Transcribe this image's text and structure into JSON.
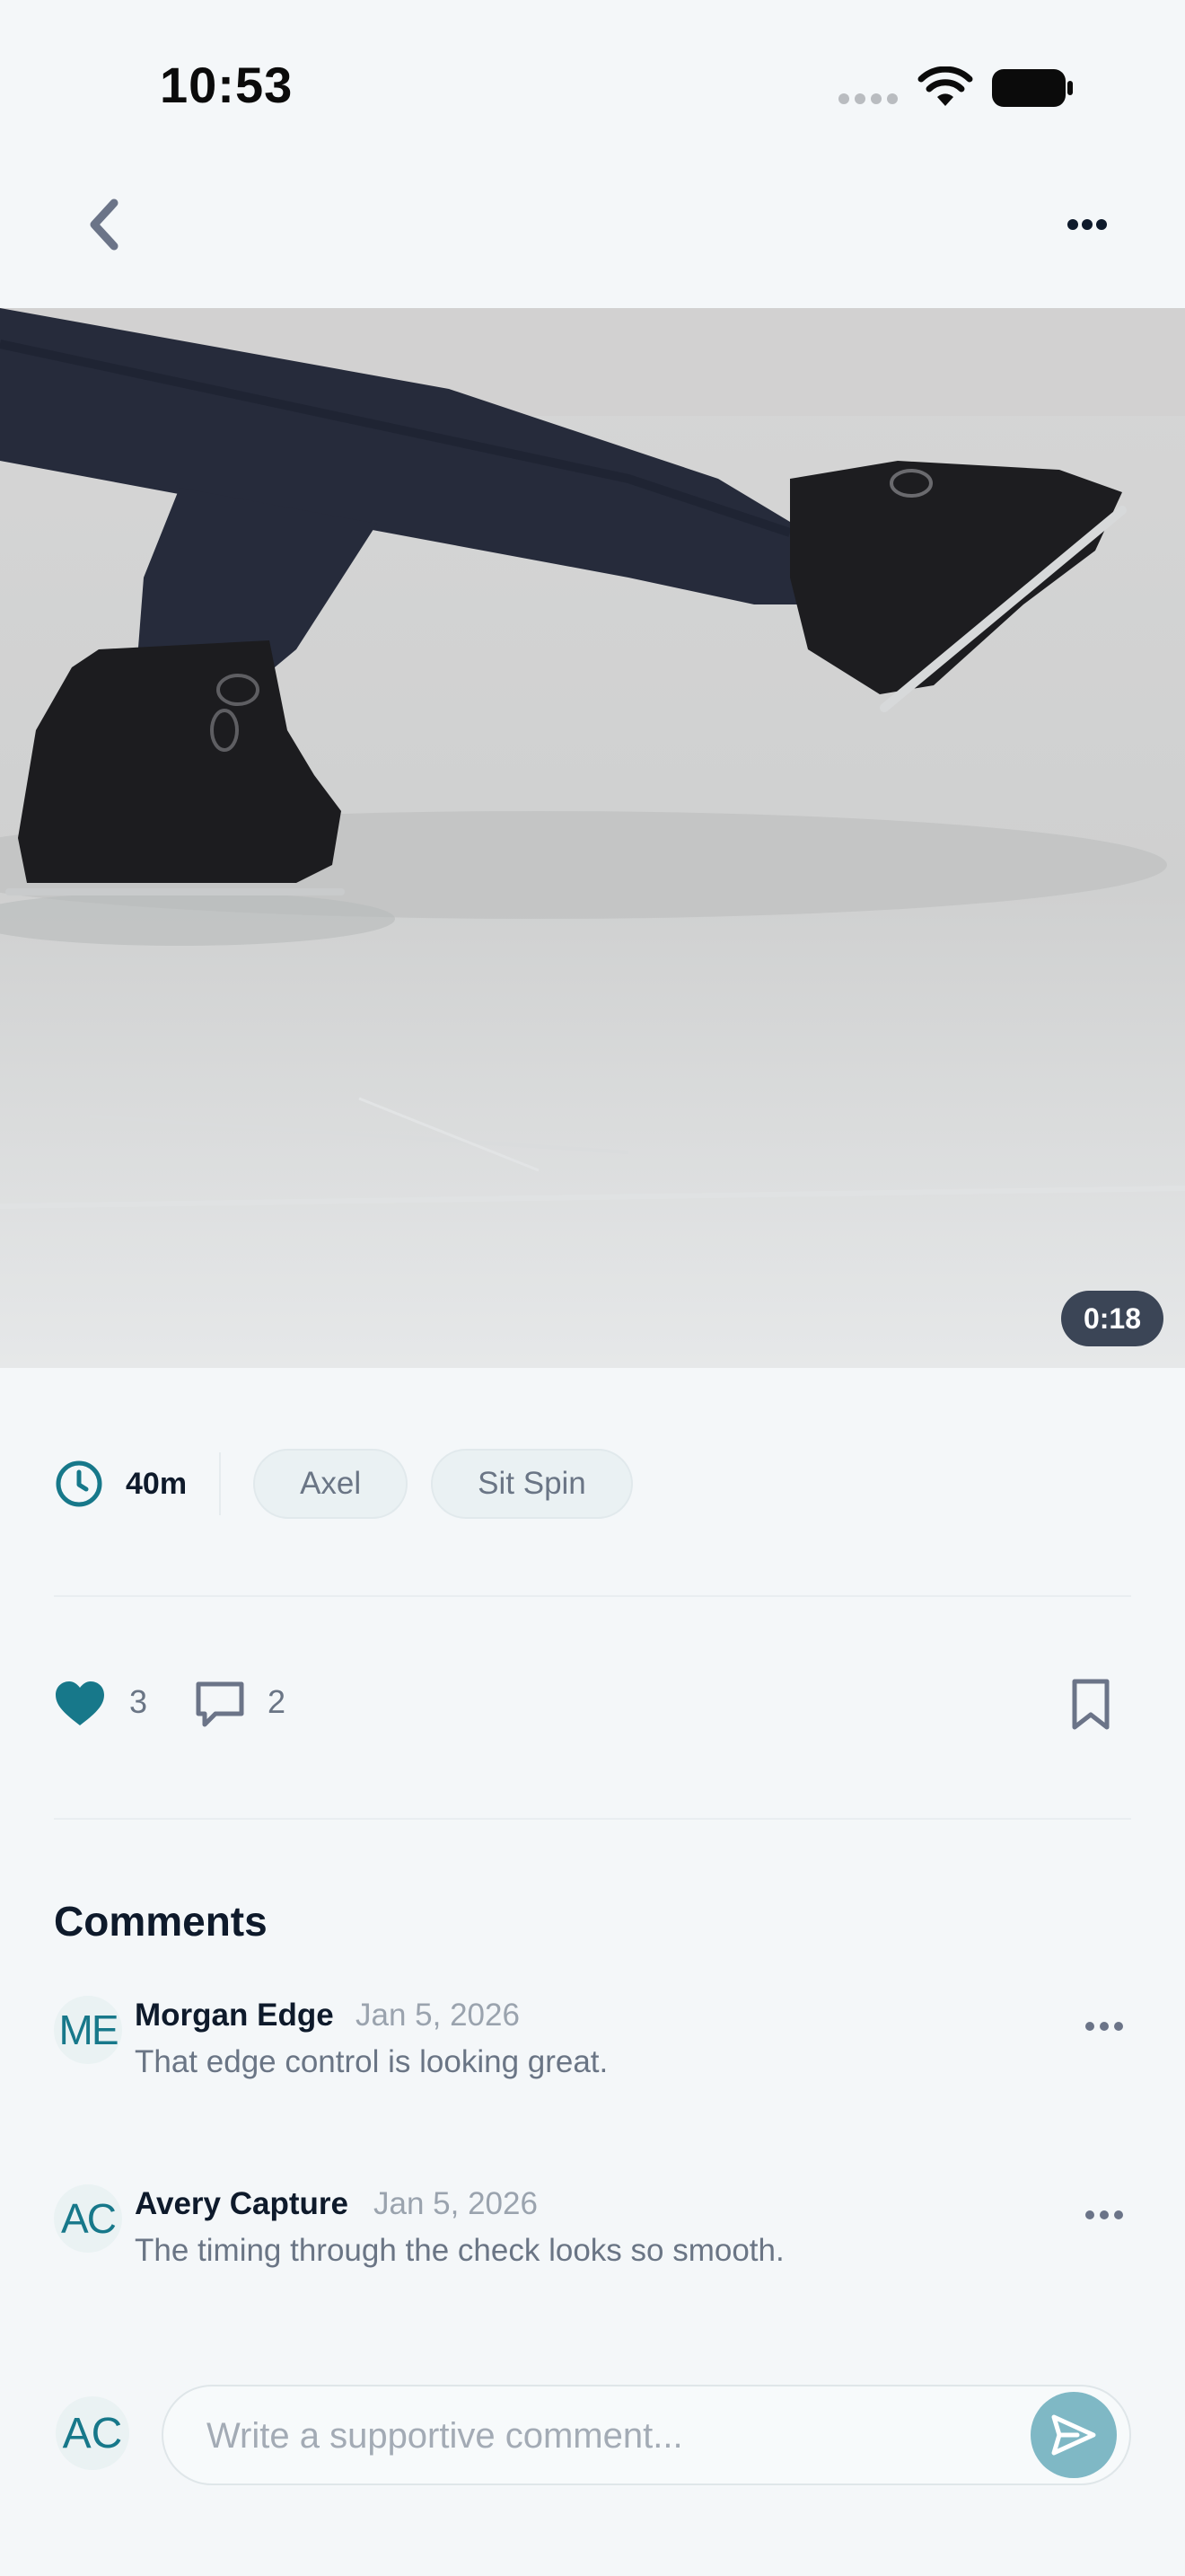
{
  "status_bar": {
    "time": "10:53"
  },
  "colors": {
    "accent": "#17788a",
    "background": "#f4f7f9",
    "text_primary": "#0e1a2b",
    "text_secondary": "#6a7585",
    "send_button": "#7fb8c5"
  },
  "nav": {
    "back_icon": "chevron-left-icon",
    "more_icon": "more-horizontal-icon"
  },
  "video": {
    "duration": "0:18"
  },
  "meta": {
    "time_spent": "40m",
    "tags": [
      "Axel",
      "Sit Spin"
    ]
  },
  "actions": {
    "likes": "3",
    "comments": "2",
    "liked": true,
    "bookmarked": false
  },
  "comments_section": {
    "title": "Comments",
    "items": [
      {
        "initials": "ME",
        "author": "Morgan Edge",
        "date": "Jan 5, 2026",
        "text": "That edge control is looking great."
      },
      {
        "initials": "AC",
        "author": "Avery Capture",
        "date": "Jan 5, 2026",
        "text": "The timing through the check looks so smooth."
      }
    ]
  },
  "composer": {
    "initials": "AC",
    "placeholder": "Write a supportive comment..."
  }
}
